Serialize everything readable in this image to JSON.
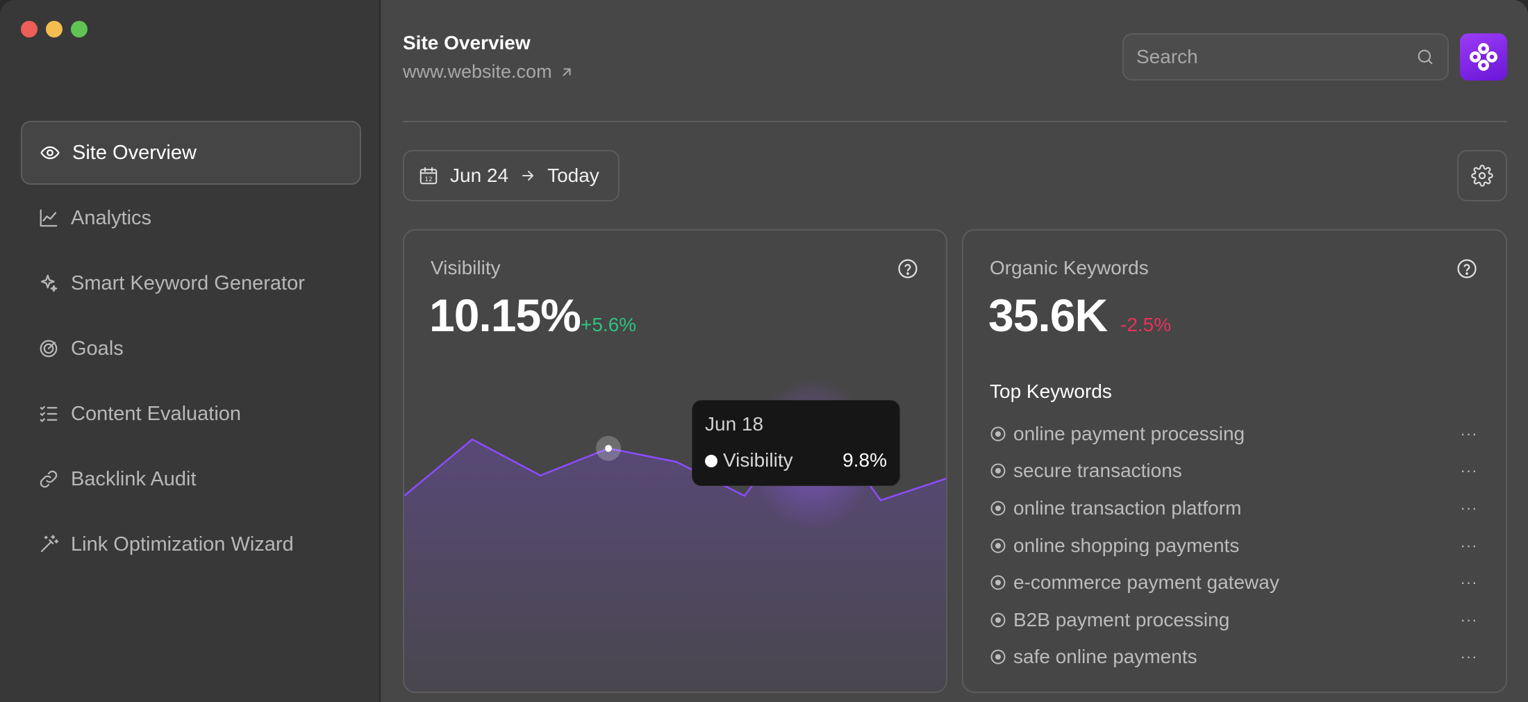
{
  "sidebar": {
    "items": [
      {
        "label": "Site Overview",
        "icon": "eye-icon",
        "active": true
      },
      {
        "label": "Analytics",
        "icon": "line-chart-icon"
      },
      {
        "label": "Smart Keyword Generator",
        "icon": "sparkle-icon"
      },
      {
        "label": "Goals",
        "icon": "target-icon"
      },
      {
        "label": "Content Evaluation",
        "icon": "checklist-icon"
      },
      {
        "label": "Backlink Audit",
        "icon": "link-icon"
      },
      {
        "label": "Link Optimization Wizard",
        "icon": "magic-wand-icon"
      }
    ]
  },
  "header": {
    "title": "Site Overview",
    "url": "www.website.com",
    "search_placeholder": "Search"
  },
  "date_range": {
    "from": "Jun 24",
    "to": "Today"
  },
  "visibility": {
    "title": "Visibility",
    "value": "10.15%",
    "delta": "+5.6%",
    "tooltip": {
      "date": "Jun 18",
      "label": "Visibility",
      "value": "9.8%"
    }
  },
  "organic_keywords": {
    "title": "Organic Keywords",
    "value": "35.6K",
    "delta": "-2.5%",
    "top_title": "Top Keywords",
    "keywords": [
      "online payment processing",
      "secure transactions",
      "online transaction platform",
      "online shopping payments",
      "e-commerce payment gateway",
      "B2B payment processing",
      "safe online payments"
    ]
  },
  "colors": {
    "accent": "#8b4dff",
    "positive": "#2ec27e",
    "negative": "#e8315b"
  },
  "chart_data": {
    "type": "area",
    "series": [
      {
        "values": [
          6.4,
          8.9,
          7.3,
          8.5,
          7.9,
          6.4,
          10.4,
          6.2,
          7.2
        ]
      }
    ],
    "highlight_index": 3,
    "ylim": [
      0,
      12
    ],
    "grid": false,
    "legend": "none"
  }
}
